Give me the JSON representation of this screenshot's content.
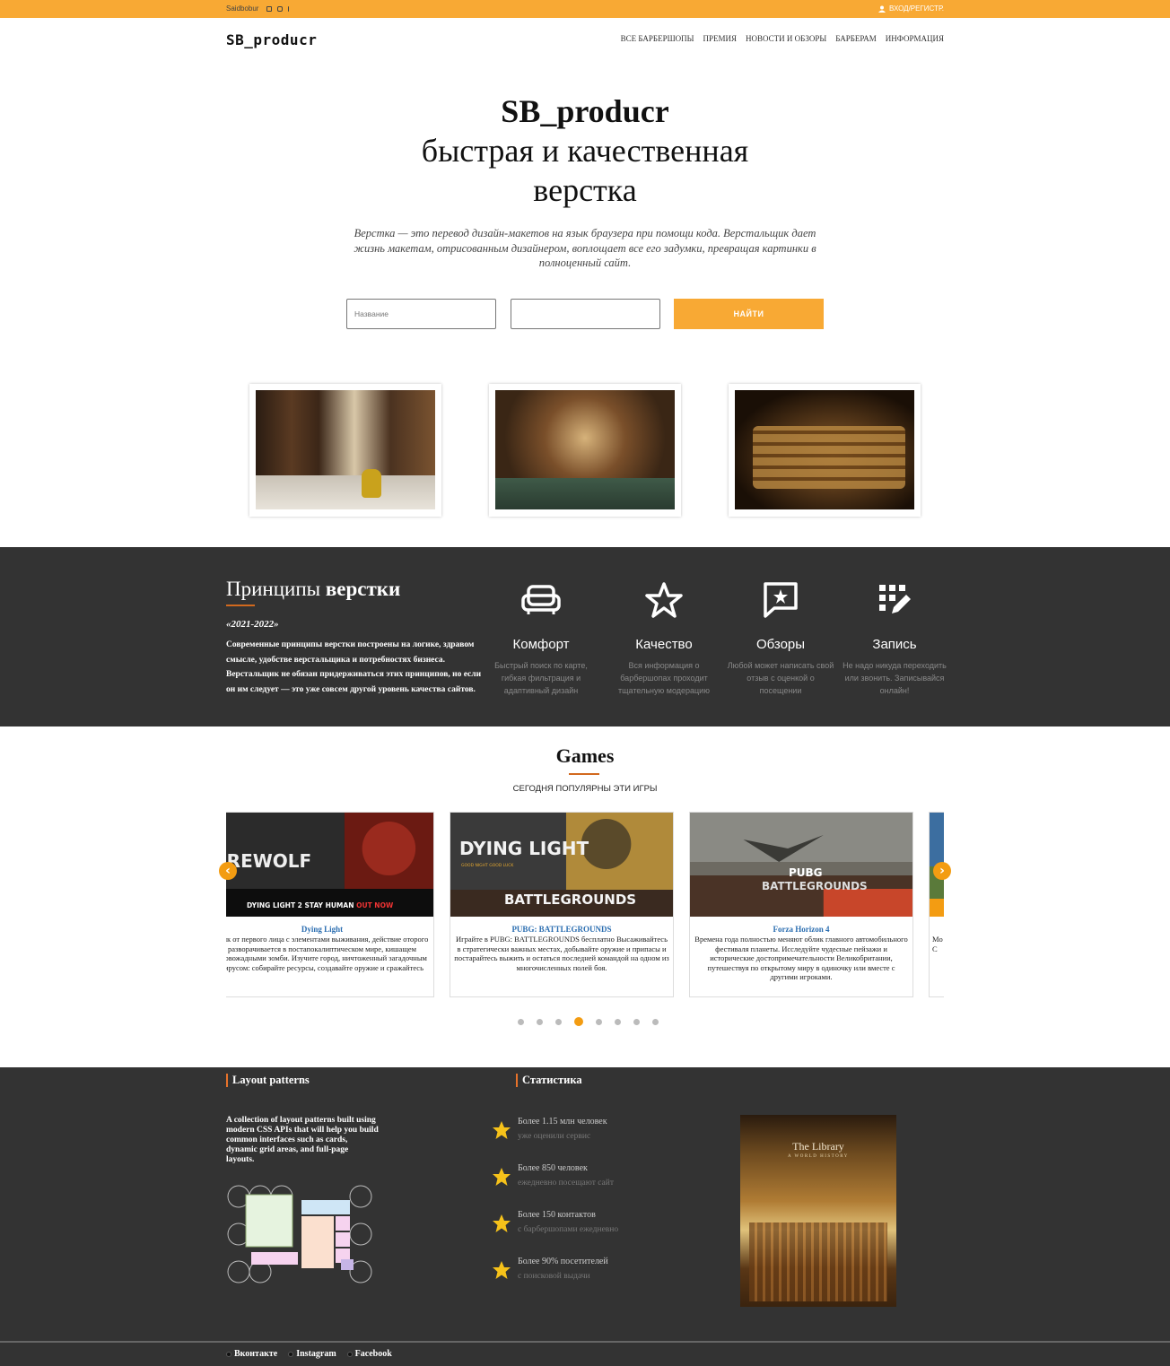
{
  "topbar": {
    "username": "Saidbobur",
    "social_icons": [
      "vk-icon",
      "instagram-icon",
      "facebook-icon"
    ],
    "login": "ВХОД/РЕГИСТР.",
    "bg_color": "#f8a934"
  },
  "header": {
    "logo": "SB_producr",
    "nav": [
      "ВСЕ БАРБЕРШОПЫ",
      "ПРЕМИЯ",
      "НОВОСТИ И ОБЗОРЫ",
      "БАРБЕРАМ",
      "ИНФОРМАЦИЯ"
    ]
  },
  "hero": {
    "title1": "SB_producr",
    "title2": "быстрая и качественная",
    "title3": "верстка",
    "description": "Верстка — это перевод дизайн-макетов на язык браузера при помощи кода. Верстальщик дает жизнь макетам, отрисованным дизайнером, воплощает все его задумки, превращая картинки в полноценный сайт.",
    "search_placeholder": "Название",
    "search_placeholder2": "",
    "find_button": "НАЙТИ"
  },
  "photos": [
    "bookshelf-interior",
    "library-hall",
    "old-books"
  ],
  "principles": {
    "title_plain": "Принципы ",
    "title_bold": "верстки",
    "years": "«2021-2022»",
    "text": "Современные принципы верстки построены на логике, здравом смысле, удобстве верстальщика и потребностях бизнеса. Верстальщик не обязан придерживаться этих принципов, но если он им следует — это уже совсем другой уровень качества сайтов.",
    "features": [
      {
        "icon": "sofa-icon",
        "title": "Комфорт",
        "desc": "Быстрый поиск по карте, гибкая фильтрация и адаптивный дизайн"
      },
      {
        "icon": "star-icon",
        "title": "Качество",
        "desc": "Вся информация о барбершопах проходит тщательную модерацию"
      },
      {
        "icon": "review-icon",
        "title": "Обзоры",
        "desc": "Любой может написать свой отзыв с оценкой о посещении"
      },
      {
        "icon": "edit-grid-icon",
        "title": "Запись",
        "desc": "Не надо никуда переходить или звонить. Записывайся онлайн!"
      }
    ]
  },
  "games": {
    "title": "Games",
    "subtitle": "СЕГОДНЯ ПОПУЛЯРНЫ ЭТИ ИГРЫ",
    "cards": [
      {
        "name": "Dying Light",
        "banner_top": "EREWOLF",
        "banner_bottom": "DYING LIGHT 2 STAY HUMAN",
        "banner_accent": "OUT NOW",
        "desc": "евик от первого лица с элементами выживания, действие оторого разворачивается в постапокалиптическом мире, кишащем кровожадными зомби. Изучите город, ничтоженный загадочным вирусом: собирайте ресурсы, создавайте оружие и сражайтесь"
      },
      {
        "name": "PUBG: BATTLEGROUNDS",
        "banner_top": "DYING LIGHT",
        "banner_tag": "GOOD NIGHT GOOD LUCK",
        "banner_bottom": "BATTLEGROUNDS",
        "desc": "Играйте в PUBG: BATTLEGROUNDS бесплатно Высаживайтесь в стратегически важных местах, добывайте оружие и припасы и постарайтесь выжить и остаться последней командой на одном из многочисленных полей боя."
      },
      {
        "name": "Forza Horizon 4",
        "banner_top": "PUBG",
        "banner_bottom": "BATTLEGROUNDS",
        "desc": "Времена года полностью меняют облик главного автомобильного фестиваля планеты. Исследуйте чудесные пейзажи и исторические достопримечательности Великобритании, путешествуя по открытому миру в одиночку или вместе с другими игроками."
      },
      {
        "name": "",
        "banner_top": "",
        "banner_bottom": "",
        "desc": "Mo С"
      }
    ],
    "dots_count": 8,
    "active_dot": 3,
    "prev_arrow": "‹",
    "next_arrow": "›"
  },
  "footer": {
    "layout_title": "Layout patterns",
    "layout_text": "A collection of layout patterns built using modern CSS APIs that will help you build common interfaces such as cards, dynamic grid areas, and full-page layouts.",
    "stats_title": "Статистика",
    "stats": [
      {
        "line1": "Более 1.15 млн человек",
        "line2": "уже оценили сервис"
      },
      {
        "line1": "Более 850 человек",
        "line2": "ежедневно посещают сайт"
      },
      {
        "line1": "Более 150 контактов",
        "line2": "с барбершопами ежедневно"
      },
      {
        "line1": "Более 90% посетителей",
        "line2": "с поисковой выдачи"
      }
    ],
    "book_title": "The Library",
    "book_subtitle": "A WORLD HISTORY"
  },
  "bottombar": {
    "links": [
      "Вконтакте",
      "Instagram",
      "Facebook"
    ]
  },
  "colors": {
    "accent": "#f8a934",
    "dark": "#333333",
    "underline": "#d2691e"
  }
}
